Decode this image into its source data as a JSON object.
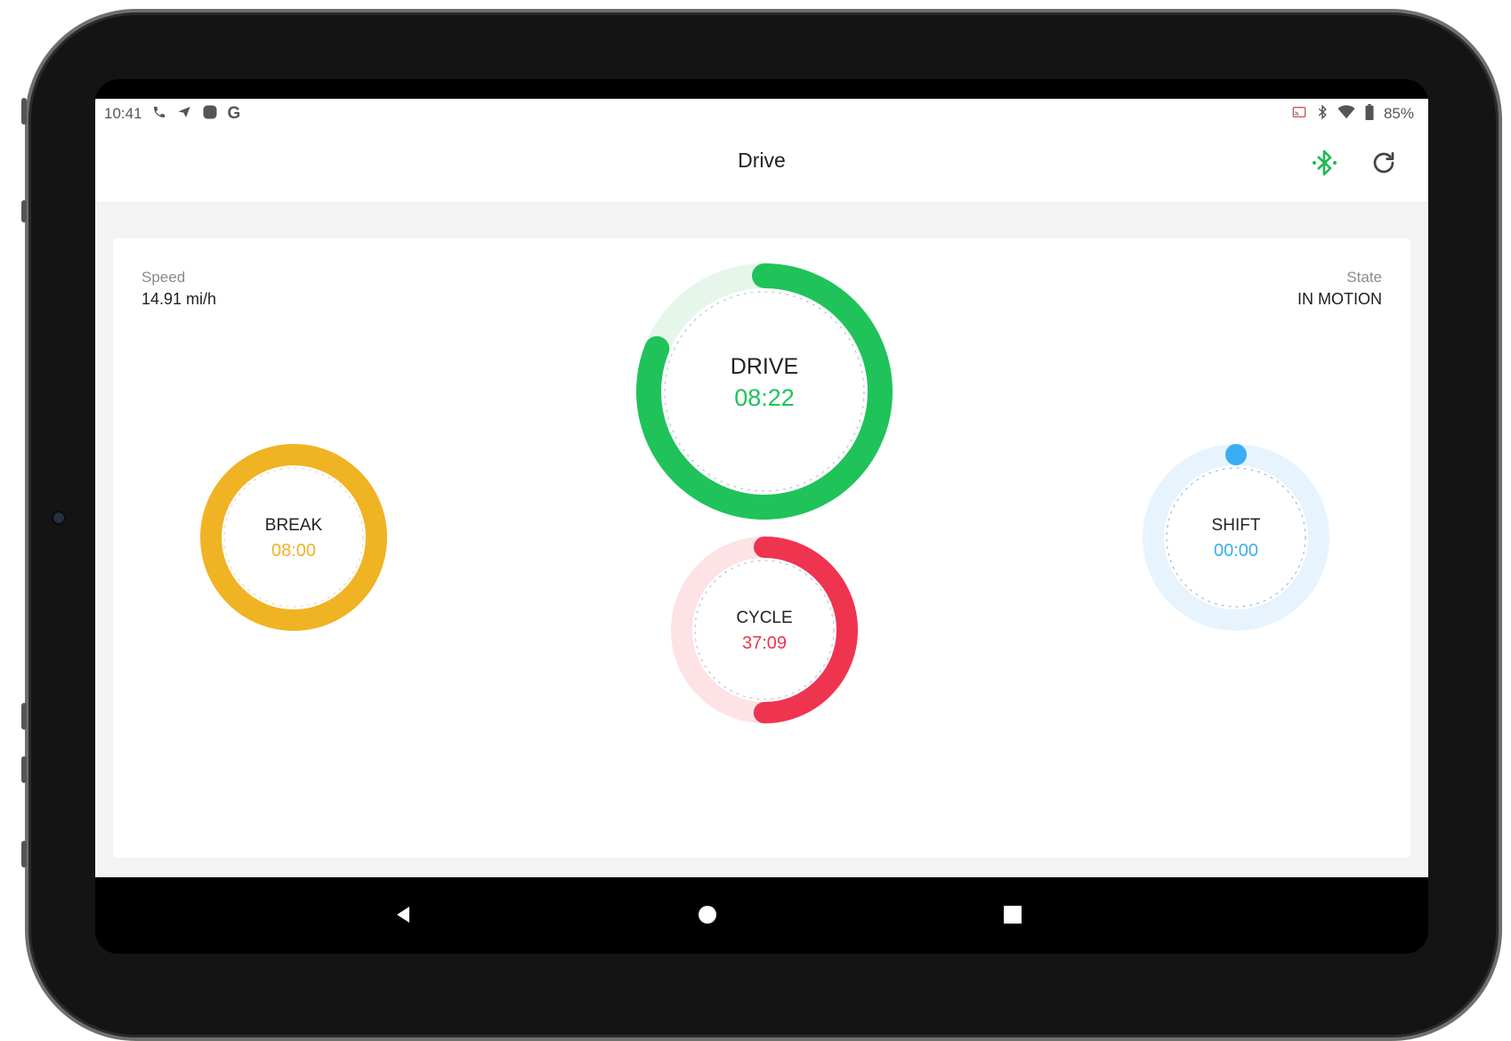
{
  "status_bar": {
    "time": "10:41",
    "left_icons": [
      "phone-icon",
      "send-icon",
      "app-icon",
      "google-icon"
    ],
    "right_icons": [
      "cast-icon",
      "bluetooth-icon",
      "wifi-icon",
      "battery-icon"
    ],
    "battery": "85%"
  },
  "app_bar": {
    "title": "Drive",
    "actions": [
      "bluetooth-icon",
      "refresh-icon"
    ],
    "bluetooth_color": "#1db954"
  },
  "info": {
    "speed_label": "Speed",
    "speed_value": "14.91 mi/h",
    "state_label": "State",
    "state_value": "IN MOTION"
  },
  "gauges": {
    "drive": {
      "label": "DRIVE",
      "value": "08:22",
      "color": "#1fc35a",
      "track": "#e6f6ea",
      "progress": 0.81
    },
    "break": {
      "label": "BREAK",
      "value": "08:00",
      "color": "#f0b323",
      "track": "#fdf1d6",
      "progress": 1.0
    },
    "cycle": {
      "label": "CYCLE",
      "value": "37:09",
      "color": "#ef3450",
      "track": "#fde2e6",
      "progress": 0.5
    },
    "shift": {
      "label": "SHIFT",
      "value": "00:00",
      "color": "#3aaef2",
      "track": "#e7f4fd",
      "progress": 0.0
    }
  },
  "nav_bar": [
    "back-icon",
    "home-icon",
    "recents-icon"
  ]
}
